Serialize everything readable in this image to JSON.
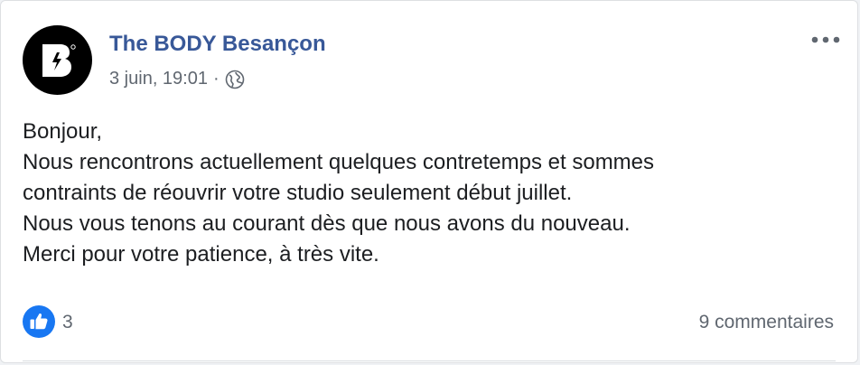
{
  "post": {
    "author": "The BODY Besançon",
    "date": "3 juin, 19:01",
    "separator": "·",
    "audience_icon": "globe-icon",
    "avatar_letter": "B",
    "text_lines": [
      "Bonjour,",
      "Nous rencontrons actuellement quelques contretemps et sommes",
      "contraints de réouvrir votre studio seulement début juillet.",
      "Nous vous tenons au courant dès que nous avons du nouveau.",
      "Merci pour votre patience, à très vite."
    ]
  },
  "reactions": {
    "icon": "like-icon",
    "count": "3",
    "comments": "9 commentaires"
  },
  "colors": {
    "author_link": "#385898",
    "like_blue": "#1877f2",
    "meta_gray": "#606770"
  }
}
